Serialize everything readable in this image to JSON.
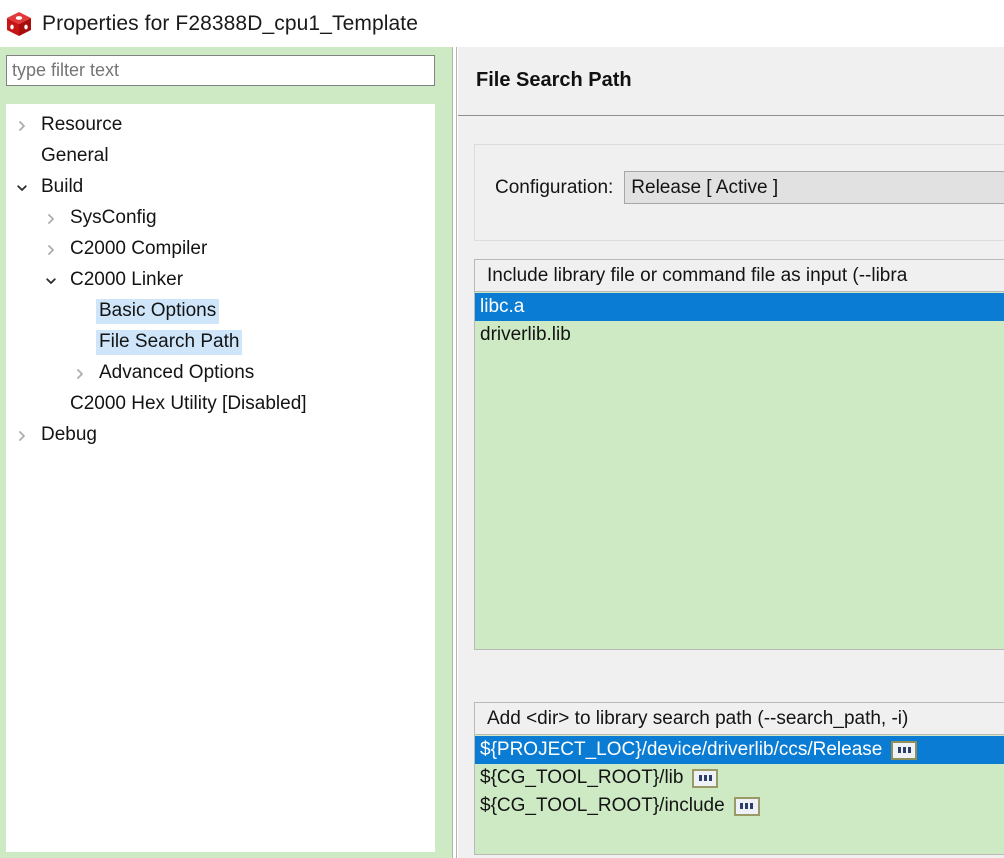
{
  "window": {
    "icon": "ccs-cube-icon",
    "title": "Properties for F28388D_cpu1_Template"
  },
  "filter": {
    "name": "filter-input",
    "value": "",
    "placeholder": "type filter text"
  },
  "tree": {
    "items": [
      {
        "label": "Resource",
        "indent": 0,
        "twisty": "collapsed",
        "selected": "none"
      },
      {
        "label": "General",
        "indent": 0,
        "twisty": "none",
        "selected": "none"
      },
      {
        "label": "Build",
        "indent": 0,
        "twisty": "expanded",
        "selected": "none"
      },
      {
        "label": "SysConfig",
        "indent": 1,
        "twisty": "collapsed",
        "selected": "none"
      },
      {
        "label": "C2000 Compiler",
        "indent": 1,
        "twisty": "collapsed",
        "selected": "none"
      },
      {
        "label": "C2000 Linker",
        "indent": 1,
        "twisty": "expanded",
        "selected": "none"
      },
      {
        "label": "Basic Options",
        "indent": 2,
        "twisty": "none",
        "selected": "soft"
      },
      {
        "label": "File Search Path",
        "indent": 2,
        "twisty": "none",
        "selected": "strong"
      },
      {
        "label": "Advanced Options",
        "indent": 2,
        "twisty": "collapsed",
        "selected": "none"
      },
      {
        "label": "C2000 Hex Utility  [Disabled]",
        "indent": 1,
        "twisty": "none",
        "selected": "none"
      },
      {
        "label": "Debug",
        "indent": 0,
        "twisty": "collapsed",
        "selected": "none"
      }
    ]
  },
  "page": {
    "title": "File Search Path",
    "configuration": {
      "label": "Configuration:",
      "value": "Release  [ Active ]"
    },
    "libraries": {
      "header": "Include library file or command file as input (--libra",
      "items": [
        {
          "text": "libc.a",
          "selected": true,
          "has_browse_button": false
        },
        {
          "text": "driverlib.lib",
          "selected": false,
          "has_browse_button": false
        }
      ]
    },
    "search_paths": {
      "header": "Add <dir> to library search path (--search_path, -i)",
      "items": [
        {
          "text": "${PROJECT_LOC}/device/driverlib/ccs/Release",
          "selected": true,
          "has_browse_button": true
        },
        {
          "text": "${CG_TOOL_ROOT}/lib",
          "selected": false,
          "has_browse_button": true
        },
        {
          "text": "${CG_TOOL_ROOT}/include",
          "selected": false,
          "has_browse_button": true
        }
      ]
    }
  },
  "colors": {
    "selection_blue": "#0a7cd4",
    "tree_selection_light": "#cfe6fa",
    "panel_green": "#cdeac4",
    "dialog_gray": "#f0f0f0",
    "icon_red": "#d81f1f"
  }
}
